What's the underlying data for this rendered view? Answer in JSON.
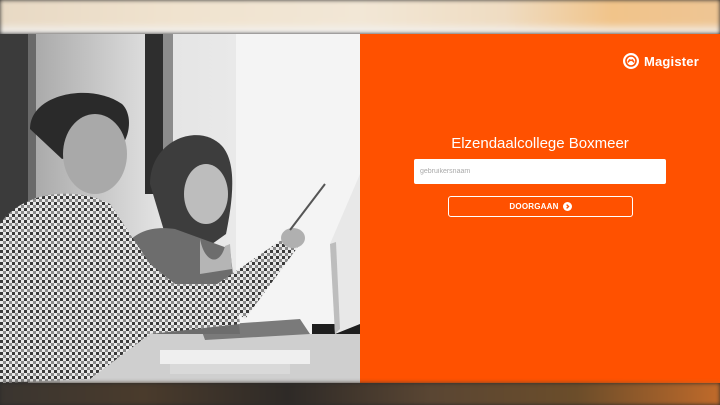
{
  "brand": {
    "name": "Magister",
    "logo_icon": "magister-logo-icon"
  },
  "login": {
    "school_name": "Elzendaalcollege Boxmeer",
    "username_placeholder": "gebruikersnaam",
    "username_value": "",
    "continue_label": "DOORGAAN",
    "continue_icon": "chevron-right-circle-icon"
  },
  "colors": {
    "accent": "#ff5100",
    "button_border": "#ffffff",
    "text": "#ffffff"
  },
  "photo": {
    "description_icon": "people-at-computer-photo"
  }
}
